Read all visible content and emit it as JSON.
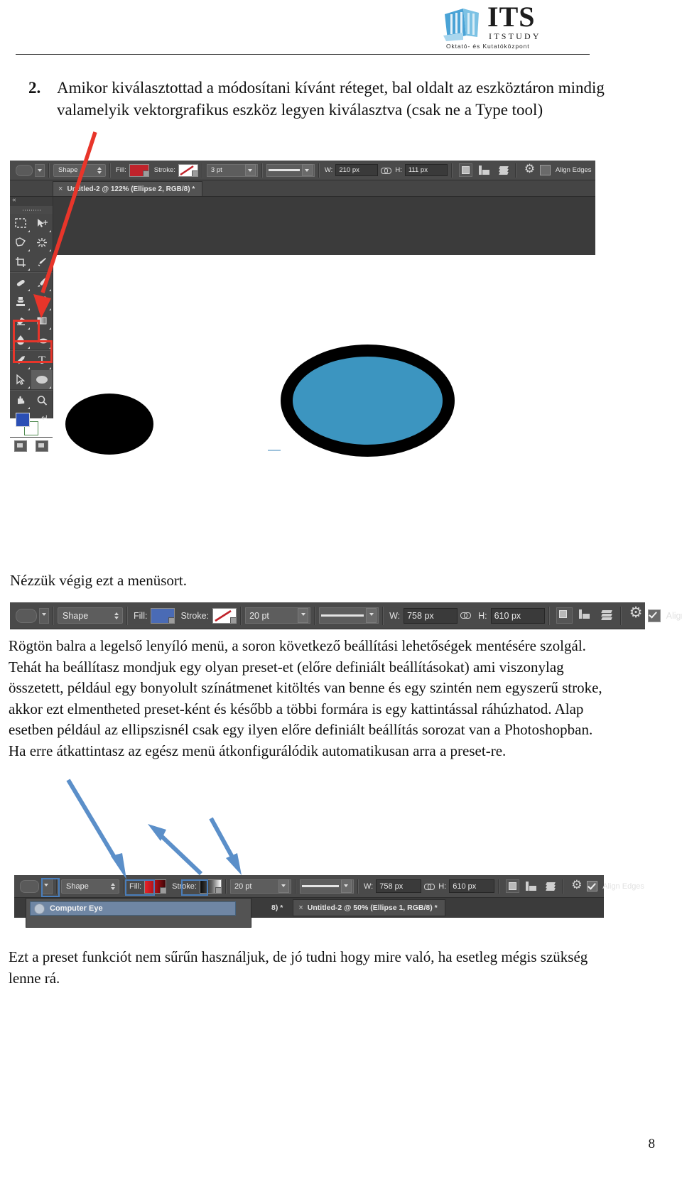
{
  "header": {
    "logo_its": "ITS",
    "logo_itstudy": "ITSTUDY",
    "logo_subtitle": "Oktató- és Kutatóközpont"
  },
  "intro": {
    "number": "2.",
    "text": "Amikor kiválasztottad a módosítani kívánt réteget, bal oldalt az eszköztáron mindig valamelyik vektorgrafikus eszköz legyen kiválasztva (csak ne a Type tool)"
  },
  "photoshop_1": {
    "tool_preset_label": "",
    "mode_select": "Shape",
    "fill_label": "Fill:",
    "fill_color": "#c0232b",
    "stroke_label": "Stroke:",
    "stroke_swatch": "none-red-slash",
    "stroke_width": "3 pt",
    "stroke_style": "solid-line",
    "w_label": "W:",
    "w_value": "210 px",
    "link_icon": "link-icon",
    "h_label": "H:",
    "h_value": "111 px",
    "path_ops_icon": "path-operations-icon",
    "path_align_icon": "path-alignment-icon",
    "path_arrange_icon": "path-arrangement-icon",
    "settings_icon": "gear-icon",
    "align_edges_label": "Align Edges",
    "align_edges_checked": false,
    "tab_title": "Untitled-2 @ 122% (Ellipse 2, RGB/8) *",
    "tab_close": "×",
    "tools": [
      {
        "name": "marquee-tool",
        "glyph": "⬚"
      },
      {
        "name": "move-tool",
        "glyph": "➤"
      },
      {
        "name": "lasso-tool",
        "glyph": "➿"
      },
      {
        "name": "magic-wand-tool",
        "glyph": "✸"
      },
      {
        "name": "crop-tool",
        "glyph": "⌘"
      },
      {
        "name": "eyedropper-tool",
        "glyph": "✒"
      },
      {
        "name": "healing-brush-tool",
        "glyph": "╱"
      },
      {
        "name": "brush-tool",
        "glyph": "✎"
      },
      {
        "name": "clone-stamp-tool",
        "glyph": "⚑"
      },
      {
        "name": "history-brush-tool",
        "glyph": "☙"
      },
      {
        "name": "eraser-tool",
        "glyph": "▱"
      },
      {
        "name": "gradient-tool",
        "glyph": "▣"
      },
      {
        "name": "blur-tool",
        "glyph": "●"
      },
      {
        "name": "dodge-tool",
        "glyph": "◕"
      },
      {
        "name": "pen-tool",
        "glyph": "✒"
      },
      {
        "name": "type-tool",
        "glyph": "T"
      },
      {
        "name": "path-selection-tool",
        "glyph": "➤"
      },
      {
        "name": "ellipse-tool",
        "glyph": "⬭"
      },
      {
        "name": "hand-tool",
        "glyph": "✋"
      },
      {
        "name": "zoom-tool",
        "glyph": "⚲"
      }
    ],
    "foreground_color": "#2b4fb5",
    "background_color": "#ffffff",
    "canvas": {
      "black_ellipse": "black-ellipse-shape",
      "blue_ellipse_fill": "#3c95c0",
      "blue_ellipse_stroke": "#000000"
    },
    "annotation_color": "#e8352a"
  },
  "mid_line": "Nézzük végig ezt a menüsort.",
  "photoshop_2": {
    "mode_select": "Shape",
    "fill_label": "Fill:",
    "fill_color": "#4a6bb5",
    "stroke_label": "Stroke:",
    "stroke_width": "20 pt",
    "w_label": "W:",
    "w_value": "758 px",
    "h_label": "H:",
    "h_value": "610 px",
    "align_edges_label": "Align Edges",
    "align_edges_checked": true
  },
  "body_paragraph": "Rögtön balra a legelső lenyíló menü, a soron következő beállítási lehetőségek mentésére szolgál. Tehát ha beállítasz mondjuk egy olyan preset-et (előre definiált beállításokat) ami viszonylag összetett, például egy bonyolult színátmenet kitöltés van benne és egy szintén nem egyszerű stroke, akkor ezt elmentheted preset-ként és később a többi formára is egy kattintással ráhúzhatod. Alap esetben például az ellipszisnél csak egy ilyen előre definiált beállítás sorozat van a Photoshopban. Ha erre átkattintasz az egész menü átkonfigurálódik automatikusan arra a preset-re.",
  "photoshop_3": {
    "mode_select": "Shape",
    "fill_label": "Fill:",
    "fill_gradient": "red-gradient",
    "stroke_label": "Stroke:",
    "stroke_gradient": "black-white-gradient",
    "stroke_width": "20 pt",
    "w_label": "W:",
    "w_value": "758 px",
    "h_label": "H:",
    "h_value": "610 px",
    "align_edges_label": "Align Edges",
    "align_edges_checked": true,
    "preset_item": "Computer Eye",
    "tab_partial": "8) *",
    "tab_title": "Untitled-2 @ 50% (Ellipse 1, RGB/8) *",
    "tab_close": "×",
    "annotation_color": "#4a7ebb"
  },
  "footer_paragraph": "Ezt a preset funkciót nem sűrűn használjuk, de jó tudni hogy mire való, ha esetleg mégis szükség lenne rá.",
  "page_number": "8"
}
